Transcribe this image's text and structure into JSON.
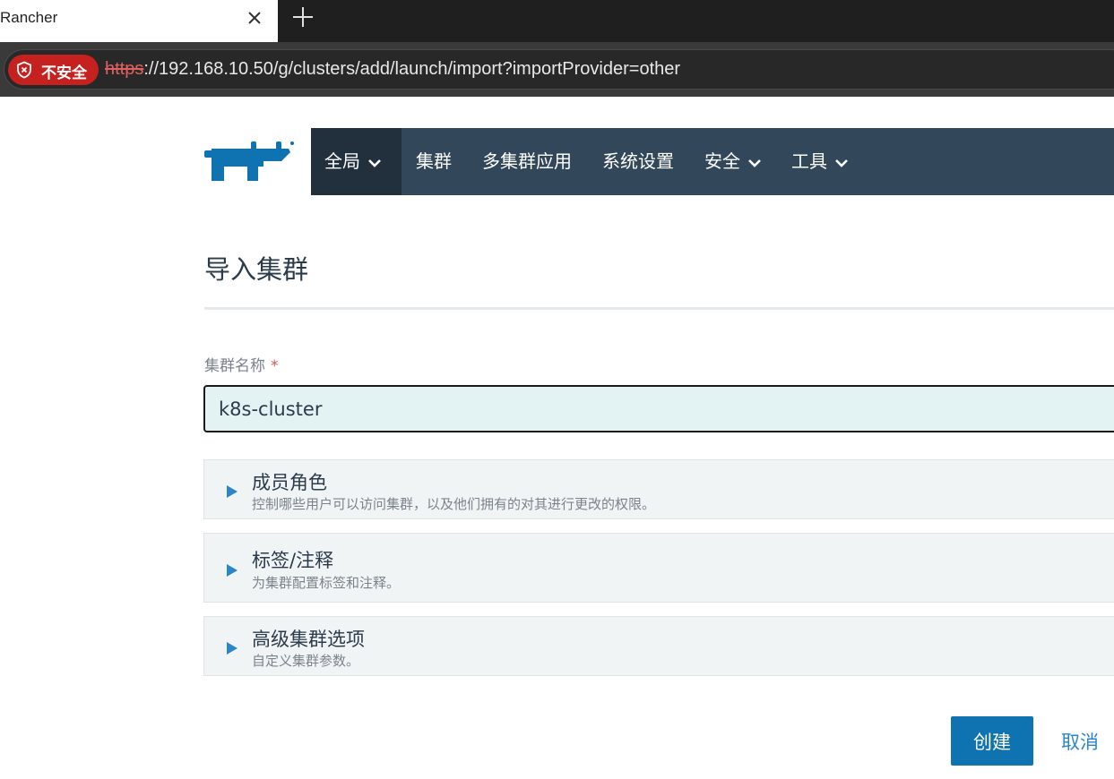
{
  "browser": {
    "tab_title": "Rancher",
    "insecure_label": "不安全",
    "url_scheme": "https",
    "url_rest": "://192.168.10.50/g/clusters/add/launch/import?importProvider=other"
  },
  "nav": {
    "items": [
      {
        "label": "全局"
      },
      {
        "label": "集群"
      },
      {
        "label": "多集群应用"
      },
      {
        "label": "系统设置"
      },
      {
        "label": "安全"
      },
      {
        "label": "工具"
      }
    ]
  },
  "page": {
    "title": "导入集群",
    "cluster_name_label": "集群名称",
    "required_mark": "*",
    "cluster_name_value": "k8s-cluster"
  },
  "sections": [
    {
      "title": "成员角色",
      "desc": "控制哪些用户可以访问集群，以及他们拥有的对其进行更改的权限。"
    },
    {
      "title": "标签/注释",
      "desc": "为集群配置标签和注释。"
    },
    {
      "title": "高级集群选项",
      "desc": "自定义集群参数。"
    }
  ],
  "actions": {
    "create_label": "创建",
    "cancel_label": "取消"
  },
  "colors": {
    "nav_bg": "#33475b",
    "nav_active_bg": "#22303d",
    "primary_button": "#0f73b2",
    "link": "#2a86c8",
    "input_bg": "#e3f3f3",
    "insecure_badge": "#c5221f"
  }
}
